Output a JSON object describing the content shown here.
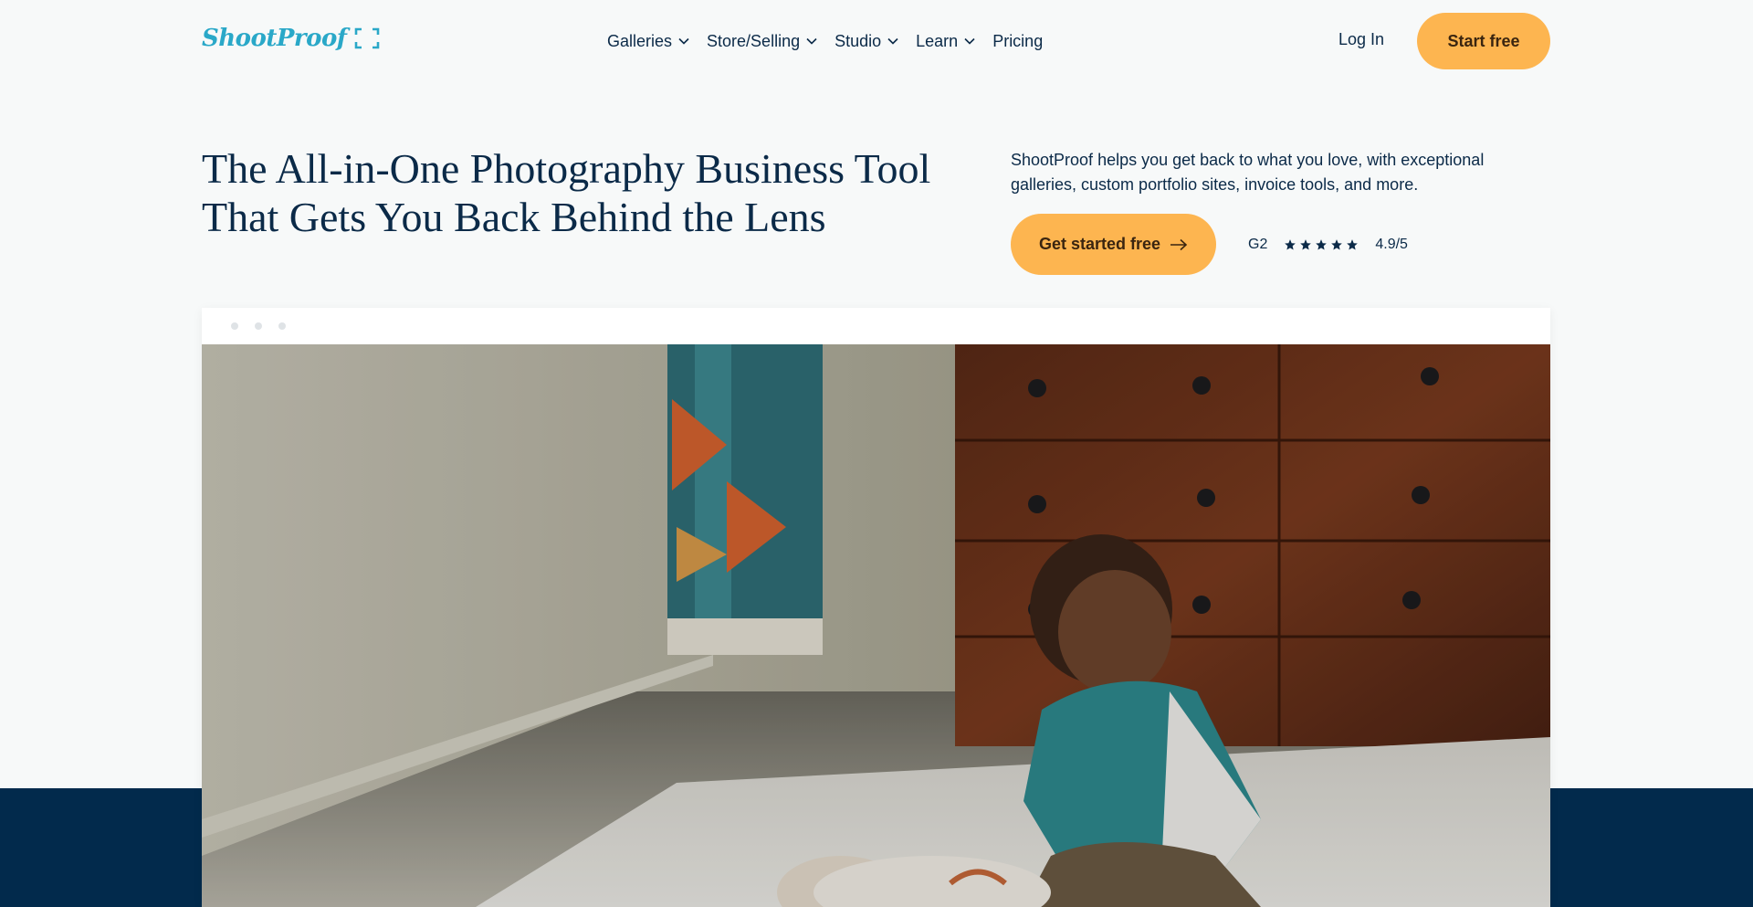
{
  "header": {
    "logo_text": "ShootProof",
    "nav": [
      {
        "label": "Galleries",
        "has_dropdown": true
      },
      {
        "label": "Store/Selling",
        "has_dropdown": true
      },
      {
        "label": "Studio",
        "has_dropdown": true
      },
      {
        "label": "Learn",
        "has_dropdown": true
      },
      {
        "label": "Pricing",
        "has_dropdown": false
      }
    ],
    "login_label": "Log In",
    "start_free_label": "Start free"
  },
  "hero": {
    "title_line1": "The All-in-One Photography Business Tool",
    "title_line2": "That Gets You Back Behind the Lens",
    "description": "ShootProof helps you get back to what you love, with exceptional galleries, custom portfolio sites, invoice tools, and more.",
    "cta_label": "Get started free",
    "rating_source": "G2",
    "rating_value": "4.9/5",
    "rating_stars": 5
  },
  "colors": {
    "accent": "#fdb550",
    "navy": "#022a4c",
    "text": "#0b2a48",
    "logo": "#2aa8c8",
    "background": "#f7f9f9"
  },
  "icons": [
    "chevron-down-icon",
    "arrow-right-icon",
    "star-icon",
    "logo-bracket-icon"
  ]
}
